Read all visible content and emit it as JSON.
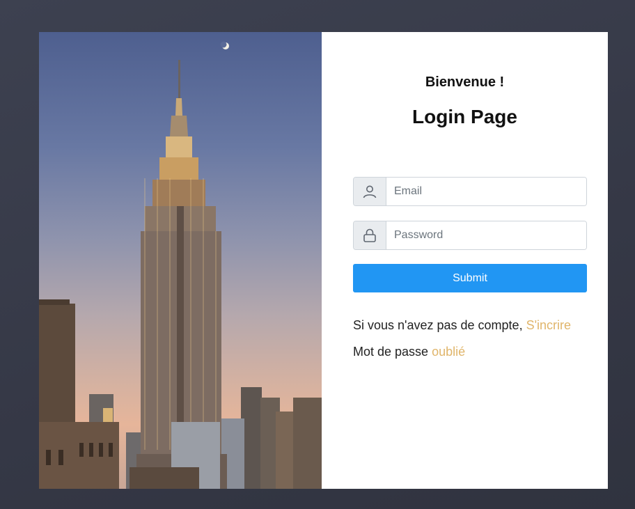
{
  "login": {
    "welcome": "Bienvenue !",
    "title": "Login Page",
    "email_placeholder": "Email",
    "password_placeholder": "Password",
    "submit_label": "Submit",
    "signup_prefix": "Si vous n'avez pas de compte,",
    "signup_link": "S'incrire",
    "forgot_prefix": "Mot de passe",
    "forgot_link": "oublié"
  },
  "icons": {
    "email_field": "user-icon",
    "password_field": "lock-icon"
  },
  "colors": {
    "submit": "#2196f3",
    "link": "#e0b56a",
    "background": "#3d4150"
  }
}
